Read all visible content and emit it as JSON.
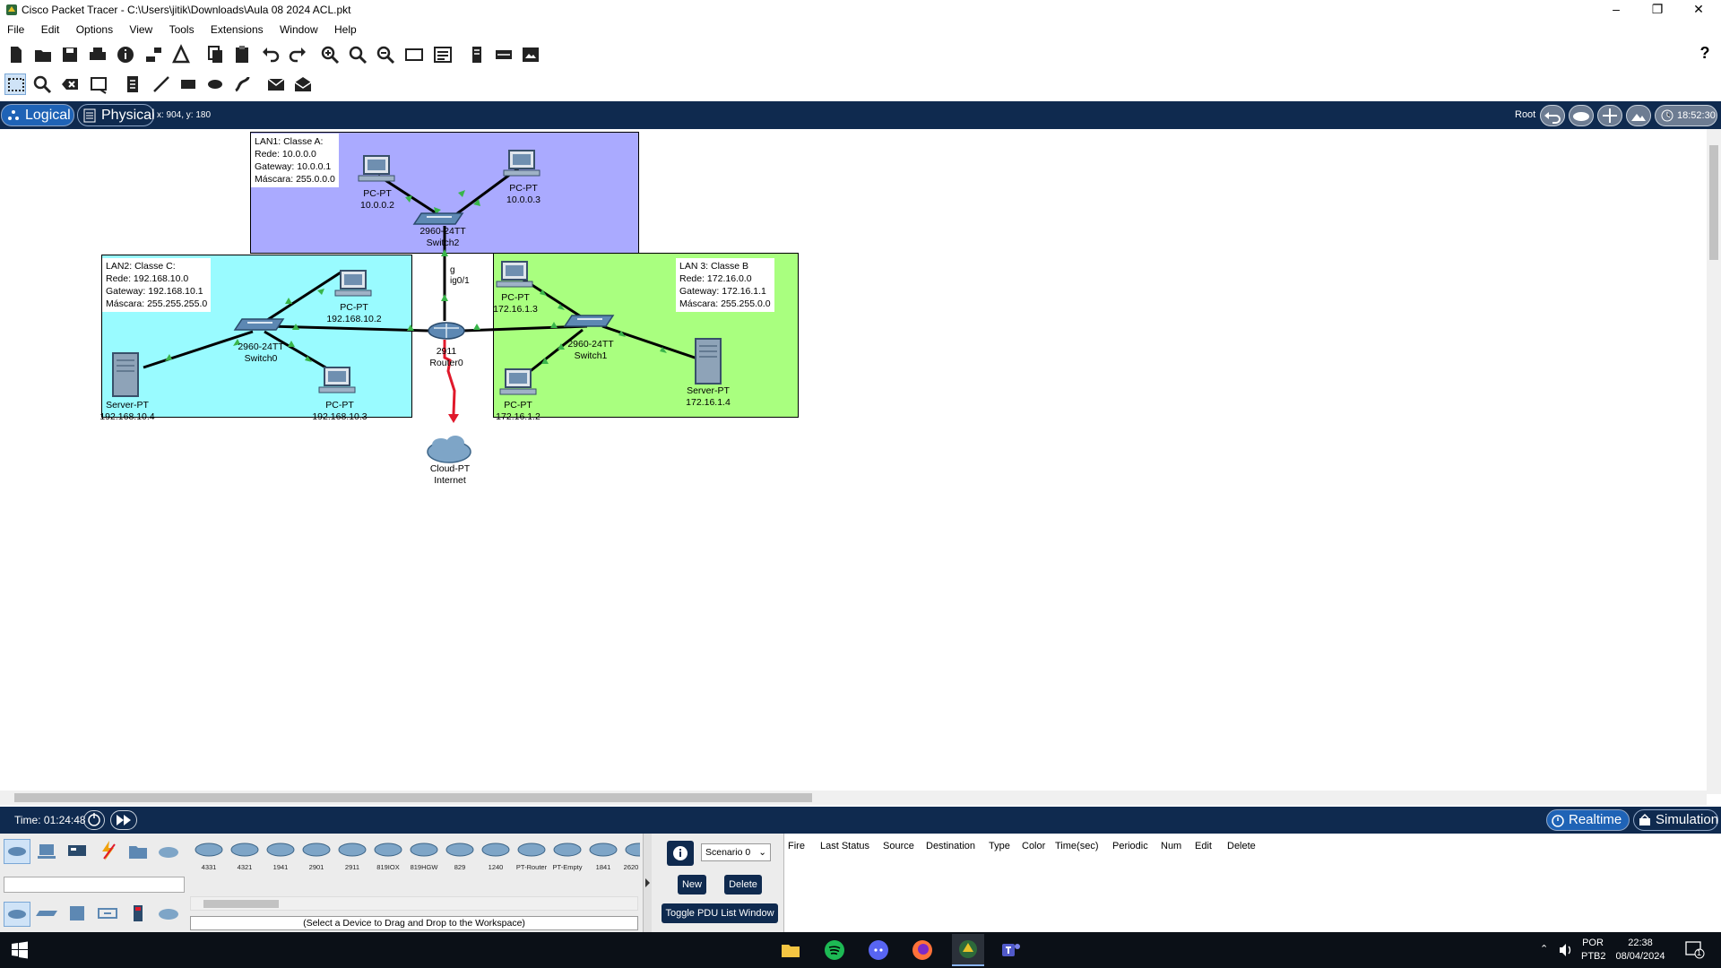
{
  "window": {
    "title": "Cisco Packet Tracer - C:\\Users\\jitik\\Downloads\\Aula 08 2024 ACL.pkt"
  },
  "menu": [
    "File",
    "Edit",
    "Options",
    "View",
    "Tools",
    "Extensions",
    "Window",
    "Help"
  ],
  "help_icon": "?",
  "modebar": {
    "logical": "Logical",
    "physical": "Physical",
    "coords": "x: 904, y: 180",
    "root": "Root",
    "clock": "18:52:30"
  },
  "notes": {
    "lan1": "LAN1: Classe A:\nRede: 10.0.0.0\nGateway: 10.0.0.1\nMáscara: 255.0.0.0",
    "lan2": "LAN2: Classe C:\nRede: 192.168.10.0\nGateway: 192.168.10.1\nMáscara: 255.255.255.0",
    "lan3": "LAN 3: Classe B\nRede: 172.16.0.0\nGateway: 172.16.1.1\nMáscara: 255.255.0.0"
  },
  "devices": {
    "pc_lan1_a": {
      "type": "PC-PT",
      "ip": "10.0.0.2"
    },
    "pc_lan1_b": {
      "type": "PC-PT",
      "ip": "10.0.0.3"
    },
    "switch2": {
      "model": "2960-24TT",
      "name": "Switch2"
    },
    "pc_lan2_a": {
      "type": "PC-PT",
      "ip": "192.168.10.2"
    },
    "pc_lan2_b": {
      "type": "PC-PT",
      "ip": "192.168.10.3"
    },
    "server_lan2": {
      "type": "Server-PT",
      "ip": "192.168.10.4"
    },
    "switch0": {
      "model": "2960-24TT",
      "name": "Switch0"
    },
    "router0": {
      "model": "2911",
      "name": "Router0"
    },
    "pc_lan3_a": {
      "type": "PC-PT",
      "ip": "172.16.1.3"
    },
    "pc_lan3_b": {
      "type": "PC-PT",
      "ip": "172.16.1.2"
    },
    "server_lan3": {
      "type": "Server-PT",
      "ip": "172.16.1.4"
    },
    "switch1": {
      "model": "2960-24TT",
      "name": "Switch1"
    },
    "cloud": {
      "type": "Cloud-PT",
      "name": "Internet"
    }
  },
  "port_labels": {
    "p1": "g",
    "p2": "ig0/1"
  },
  "colors": {
    "lan1": "#aaaaff",
    "lan2": "#99fbff",
    "lan3": "#a9ff7f",
    "link": "#000000",
    "link_up": "#39b54a",
    "serial_link": "#e0192b",
    "navy": "#0f2a4f"
  },
  "timebar": {
    "time": "Time: 01:24:48",
    "realtime": "Realtime",
    "simulation": "Simulation"
  },
  "device_models": [
    "4331",
    "4321",
    "1941",
    "2901",
    "2911",
    "819IOX",
    "819HGW",
    "829",
    "1240",
    "PT-Router",
    "PT-Empty",
    "1841",
    "2620"
  ],
  "device_hint": "(Select a Device to Drag and Drop to the Workspace)",
  "scenario": {
    "select": "Scenario 0",
    "new": "New",
    "delete": "Delete",
    "toggle": "Toggle PDU List Window"
  },
  "pdu_columns": [
    "Fire",
    "Last Status",
    "Source",
    "Destination",
    "Type",
    "Color",
    "Time(sec)",
    "Periodic",
    "Num",
    "Edit",
    "Delete"
  ],
  "tray": {
    "lang1": "POR",
    "lang2": "PTB2",
    "time": "22:38",
    "date": "08/04/2024",
    "notif": "1"
  }
}
